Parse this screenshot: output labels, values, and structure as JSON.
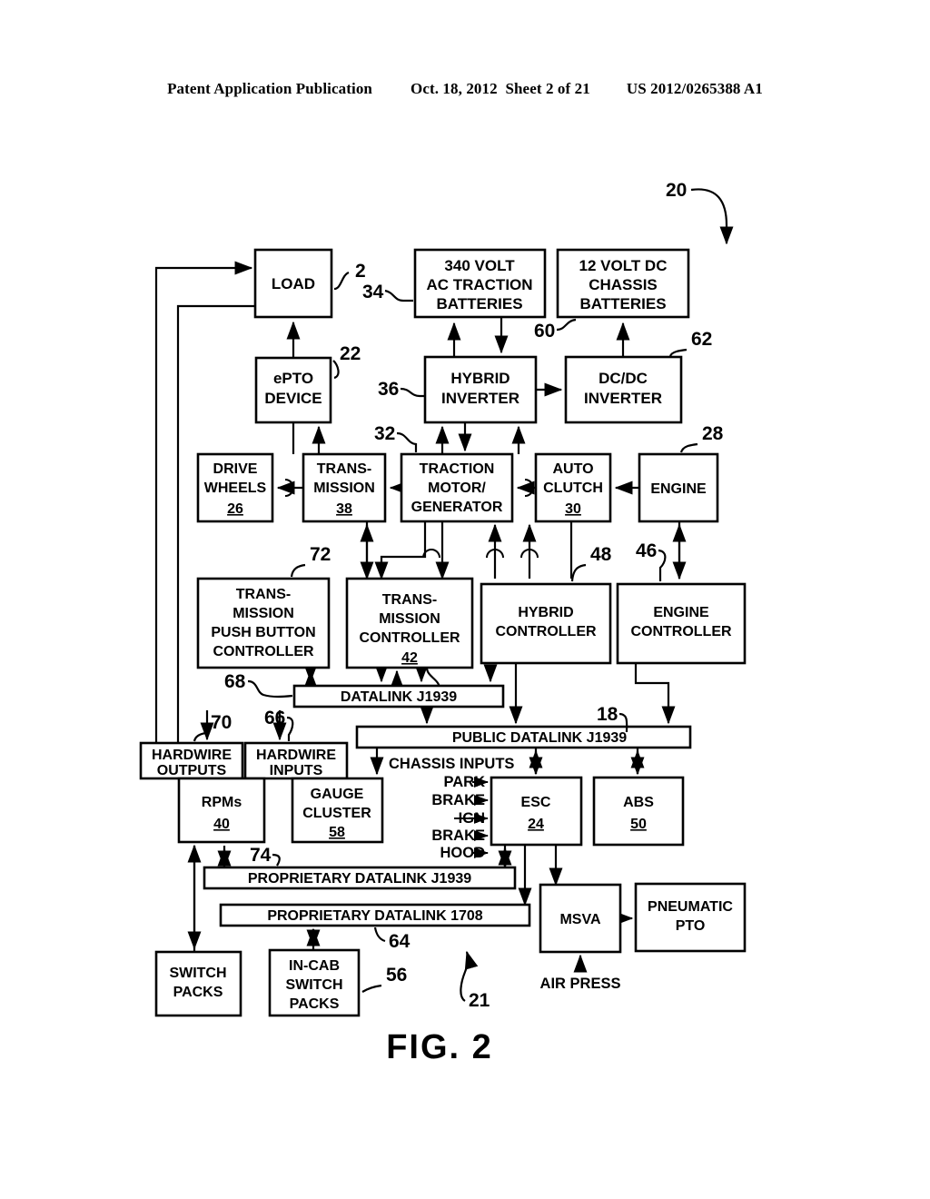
{
  "header": {
    "publication": "Patent Application Publication",
    "date": "Oct. 18, 2012",
    "sheet": "Sheet 2 of 21",
    "patent_number": "US 2012/0265388 A1"
  },
  "figure": {
    "caption": "FIG. 2",
    "system_ref": "20",
    "subsystem_ref": "21"
  },
  "blocks": {
    "load": {
      "line1": "LOAD",
      "ref": "2"
    },
    "ac_batteries": {
      "line1": "340 VOLT",
      "line2": "AC TRACTION",
      "line3": "BATTERIES",
      "ref": "34"
    },
    "dc_batteries": {
      "line1": "12 VOLT DC",
      "line2": "CHASSIS",
      "line3": "BATTERIES",
      "ref": "60"
    },
    "epto": {
      "line1": "ePTO",
      "line2": "DEVICE",
      "ref": "22"
    },
    "hybrid_inverter": {
      "line1": "HYBRID",
      "line2": "INVERTER",
      "ref": "36"
    },
    "dcdc_inverter": {
      "line1": "DC/DC",
      "line2": "INVERTER",
      "ref": "62"
    },
    "drive_wheels": {
      "line1": "DRIVE",
      "line2": "WHEELS",
      "num": "26"
    },
    "transmission": {
      "line1": "TRANS-",
      "line2": "MISSION",
      "num": "38"
    },
    "traction_motor": {
      "line1": "TRACTION",
      "line2": "MOTOR/",
      "line3": "GENERATOR",
      "ref": "32"
    },
    "auto_clutch": {
      "line1": "AUTO",
      "line2": "CLUTCH",
      "num": "30"
    },
    "engine": {
      "line1": "ENGINE",
      "ref": "28"
    },
    "trans_push_button_controller": {
      "line1": "TRANS-",
      "line2": "MISSION",
      "line3": "PUSH BUTTON",
      "line4": "CONTROLLER",
      "ref": "72"
    },
    "transmission_controller": {
      "line1": "TRANS-",
      "line2": "MISSION",
      "line3": "CONTROLLER",
      "num": "42"
    },
    "hybrid_controller": {
      "line1": "HYBRID",
      "line2": "CONTROLLER",
      "ref": "48"
    },
    "engine_controller": {
      "line1": "ENGINE",
      "line2": "CONTROLLER",
      "ref": "46"
    },
    "hardwire_outputs": {
      "line1": "HARDWIRE",
      "line2": "OUTPUTS",
      "ref": "70"
    },
    "hardwire_inputs": {
      "line1": "HARDWIRE",
      "line2": "INPUTS",
      "ref": "66"
    },
    "rpms": {
      "line1": "RPMs",
      "num": "40"
    },
    "gauge_cluster": {
      "line1": "GAUGE",
      "line2": "CLUSTER",
      "num": "58"
    },
    "esc": {
      "line1": "ESC",
      "num": "24"
    },
    "abs": {
      "line1": "ABS",
      "num": "50"
    },
    "msva": {
      "line1": "MSVA"
    },
    "pneumatic_pto": {
      "line1": "PNEUMATIC",
      "line2": "PTO"
    },
    "switch_packs": {
      "line1": "SWITCH",
      "line2": "PACKS"
    },
    "in_cab_switch_packs": {
      "line1": "IN-CAB",
      "line2": "SWITCH",
      "line3": "PACKS",
      "ref": "56"
    }
  },
  "buses": {
    "datalink_j1939": {
      "label": "DATALINK J1939",
      "ref": "68"
    },
    "public_datalink_j1939": {
      "label": "PUBLIC DATALINK J1939",
      "ref": "18"
    },
    "proprietary_datalink_j1939": {
      "label": "PROPRIETARY DATALINK J1939",
      "ref": "74"
    },
    "proprietary_datalink_1708": {
      "label": "PROPRIETARY DATALINK 1708",
      "ref": "64"
    }
  },
  "annotations": {
    "chassis_inputs_title": "CHASSIS INPUTS",
    "chassis_inputs": [
      "PARK",
      "BRAKE",
      "IGN",
      "BRAKE",
      "HOOD"
    ],
    "air_press": "AIR PRESS"
  }
}
